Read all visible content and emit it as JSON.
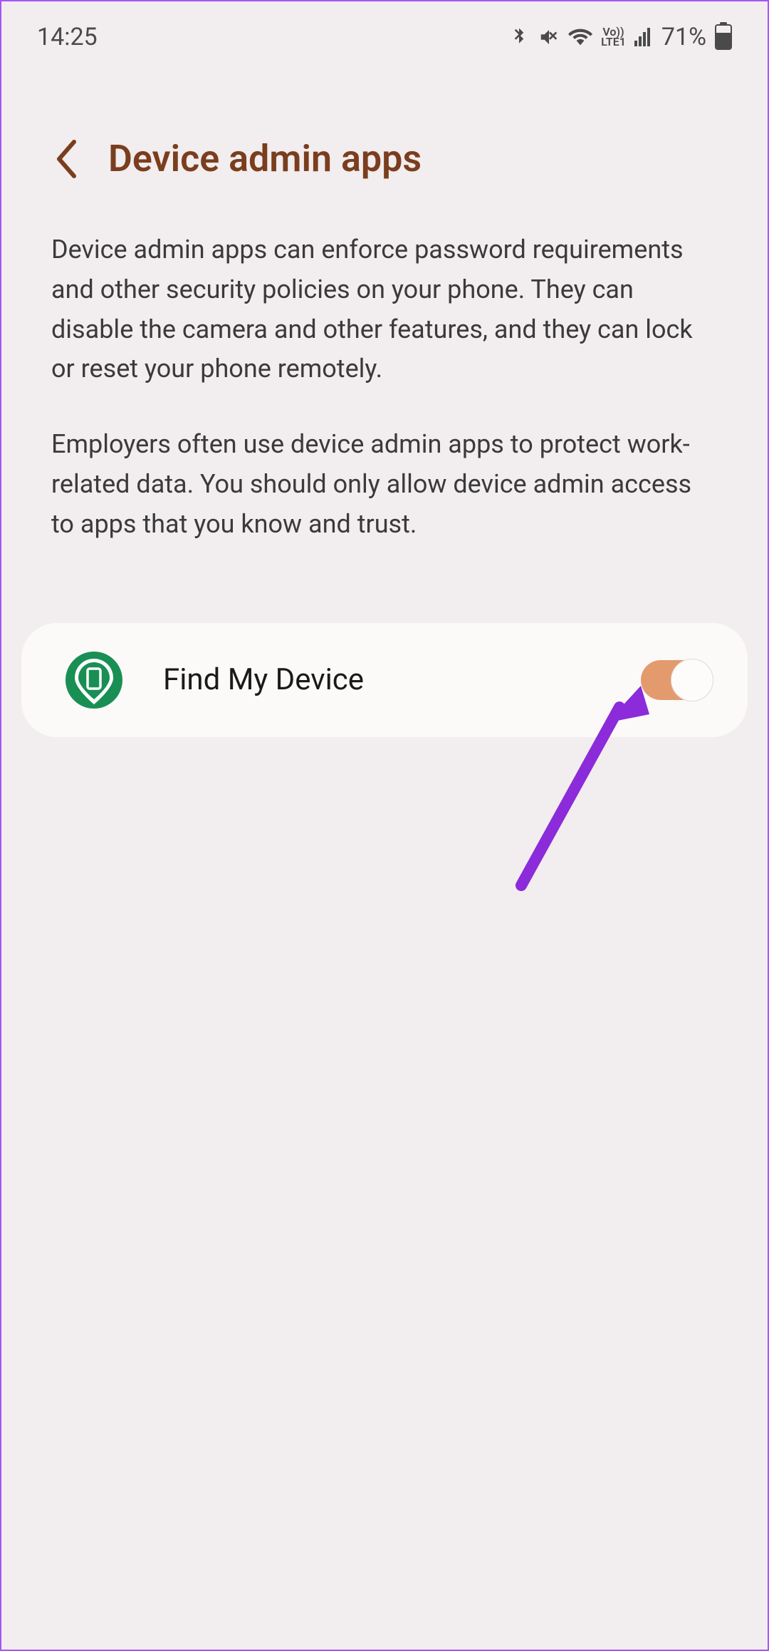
{
  "status_bar": {
    "time": "14:25",
    "battery_percent": "71%",
    "lte_label": "Vo))\nLTE1"
  },
  "header": {
    "title": "Device admin apps"
  },
  "description": {
    "paragraph1": "Device admin apps can enforce password requirements and other security policies on your phone. They can disable the camera and other features, and they can lock or reset your phone remotely.",
    "paragraph2": "Employers often use device admin apps to protect work-related data. You should only allow device admin access to apps that you know and trust."
  },
  "apps": [
    {
      "name": "Find My Device",
      "enabled": true
    }
  ]
}
